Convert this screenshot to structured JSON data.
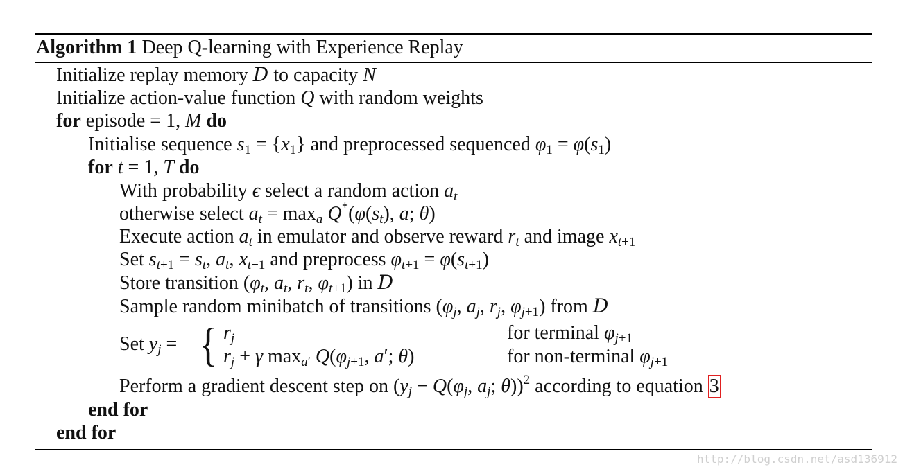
{
  "algorithm": {
    "label": "Algorithm 1",
    "title": "Deep Q-learning with Experience Replay",
    "lines": {
      "init_memory_a": "Initialize replay memory ",
      "init_memory_D": "D",
      "init_memory_b": " to capacity ",
      "init_memory_N": "N",
      "init_q_a": "Initialize action-value function ",
      "init_q_Q": "Q",
      "init_q_b": " with random weights",
      "for_kw": "for",
      "do_kw": "do",
      "end_for_kw": "end for",
      "for_episode": " episode = 1, ",
      "for_episode_M": "M",
      "init_seq": "Initialise sequence ",
      "init_seq_mid": " and preprocessed sequenced ",
      "for_t": "t",
      "for_t_rest": " = 1, ",
      "for_t_T": "T",
      "prob_a": "With probability ",
      "prob_eps": "ϵ",
      "prob_b": " select a random action ",
      "otherwise": "otherwise select ",
      "execute_a": "Execute action ",
      "execute_b": " in emulator and observe reward ",
      "execute_c": " and image ",
      "set_a": "Set ",
      "set_b": " and preprocess ",
      "store_a": "Store transition ",
      "store_b": " in ",
      "sample_a": "Sample random minibatch of transitions ",
      "sample_b": " from ",
      "set_y": "Set ",
      "case1_cond": "for terminal ",
      "case2_cond": "for non-terminal ",
      "grad_a": "Perform a gradient descent step on ",
      "grad_b": " according to equation ",
      "grad_ref": "3"
    }
  },
  "watermark": "http://blog.csdn.net/asd136912"
}
